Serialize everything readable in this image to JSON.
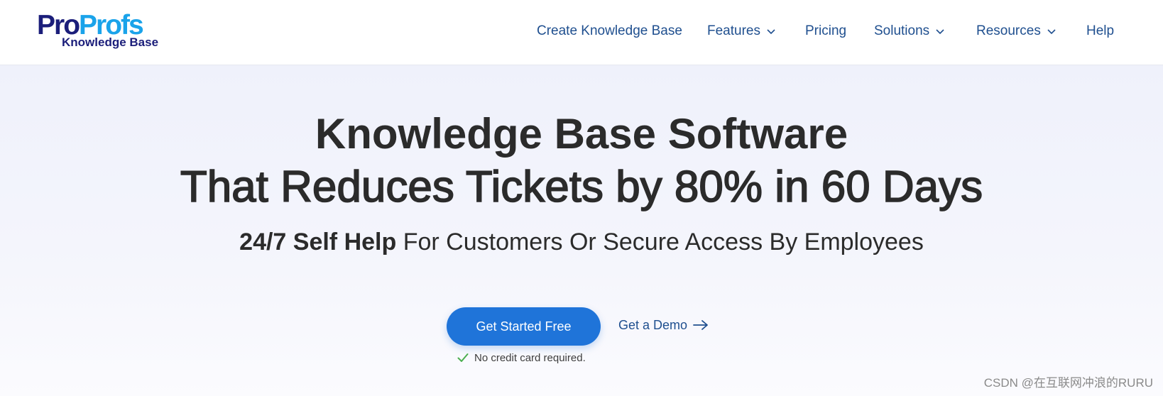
{
  "brand": {
    "logo_pro": "Pro",
    "logo_profs": "Profs",
    "logo_subtitle": "Knowledge Base",
    "colors": {
      "dark": "#1b1e7a",
      "light": "#1aa3ea"
    }
  },
  "nav": {
    "items": [
      {
        "label": "Create Knowledge Base",
        "dropdown": false
      },
      {
        "label": "Features",
        "dropdown": true
      },
      {
        "label": "Pricing",
        "dropdown": false
      },
      {
        "label": "Solutions",
        "dropdown": true
      },
      {
        "label": "Resources",
        "dropdown": true
      },
      {
        "label": "Help",
        "dropdown": false
      }
    ],
    "color": "#1f4f8f"
  },
  "hero": {
    "title_line1": "Knowledge Base Software",
    "title_line2": "That Reduces Tickets by 80% in 60 Days",
    "subtitle_bold": "24/7 Self Help",
    "subtitle_rest": " For Customers Or Secure Access By Employees",
    "primary_cta": "Get Started Free",
    "secondary_cta": "Get a Demo",
    "note": "No credit card required.",
    "accent_color": "#1f74d9",
    "check_color": "#4caf50"
  },
  "watermark": "CSDN @在互联网冲浪的RURU"
}
